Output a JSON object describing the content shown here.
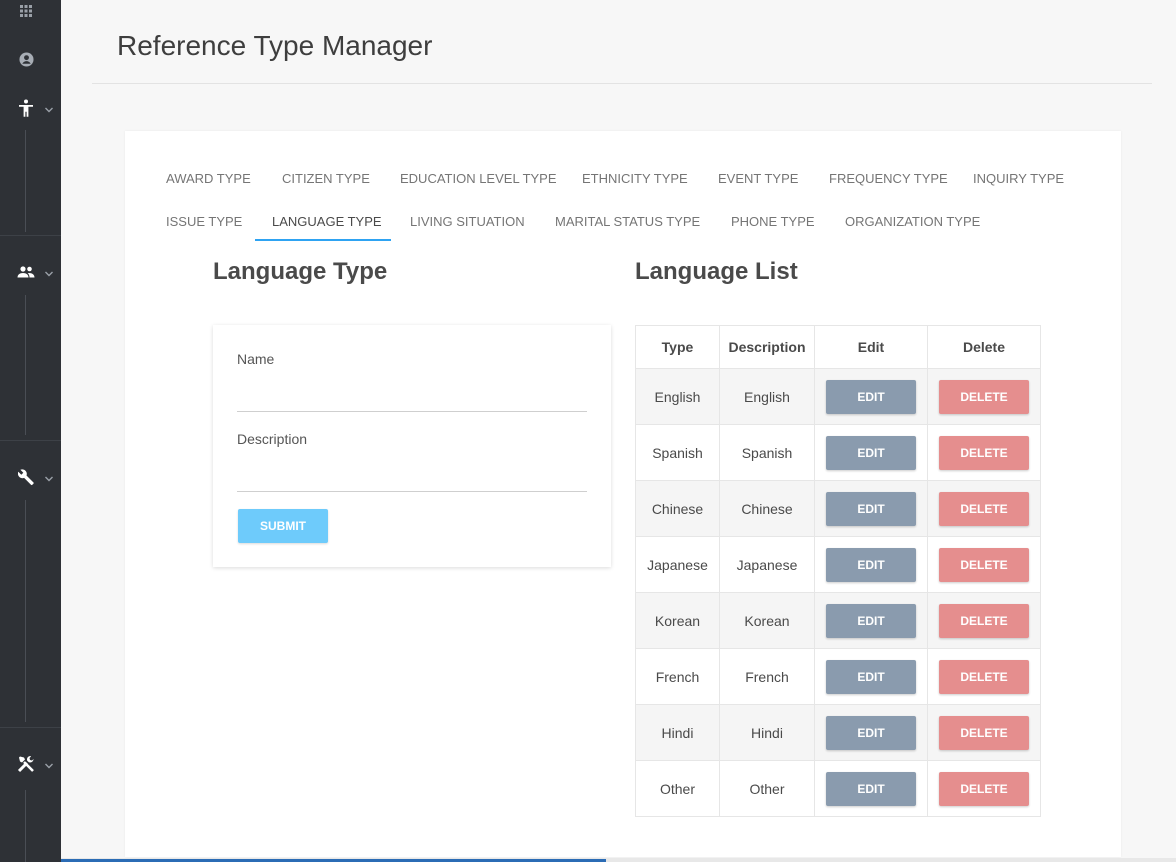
{
  "sidebar": {
    "icons": [
      "apps-grid-icon",
      "account-circle-icon",
      "accessibility-icon",
      "people-icon",
      "wrench-icon",
      "tools-icon"
    ]
  },
  "header": {
    "title": "Reference Type Manager"
  },
  "tabs": {
    "row1": [
      "AWARD TYPE",
      "CITIZEN TYPE",
      "EDUCATION LEVEL TYPE",
      "ETHNICITY TYPE",
      "EVENT TYPE",
      "FREQUENCY TYPE",
      "INQUIRY TYPE"
    ],
    "row2": [
      "ISSUE TYPE",
      "LANGUAGE TYPE",
      "LIVING SITUATION",
      "MARITAL STATUS TYPE",
      "PHONE TYPE",
      "ORGANIZATION TYPE"
    ],
    "active": "LANGUAGE TYPE"
  },
  "form": {
    "title": "Language Type",
    "name_label": "Name",
    "name_value": "",
    "description_label": "Description",
    "description_value": "",
    "submit_label": "SUBMIT"
  },
  "list": {
    "title": "Language List",
    "columns": [
      "Type",
      "Description",
      "Edit",
      "Delete"
    ],
    "edit_label": "EDIT",
    "delete_label": "DELETE",
    "rows": [
      {
        "type": "English",
        "description": "English"
      },
      {
        "type": "Spanish",
        "description": "Spanish"
      },
      {
        "type": "Chinese",
        "description": "Chinese"
      },
      {
        "type": "Japanese",
        "description": "Japanese"
      },
      {
        "type": "Korean",
        "description": "Korean"
      },
      {
        "type": "French",
        "description": "French"
      },
      {
        "type": "Hindi",
        "description": "Hindi"
      },
      {
        "type": "Other",
        "description": "Other"
      }
    ]
  },
  "colors": {
    "sidebar_bg": "#2e3136",
    "active_tab_underline": "#2ea3f2",
    "submit_button": "#6ecbfb",
    "edit_button": "#8a9bae",
    "delete_button": "#e58e8e"
  }
}
